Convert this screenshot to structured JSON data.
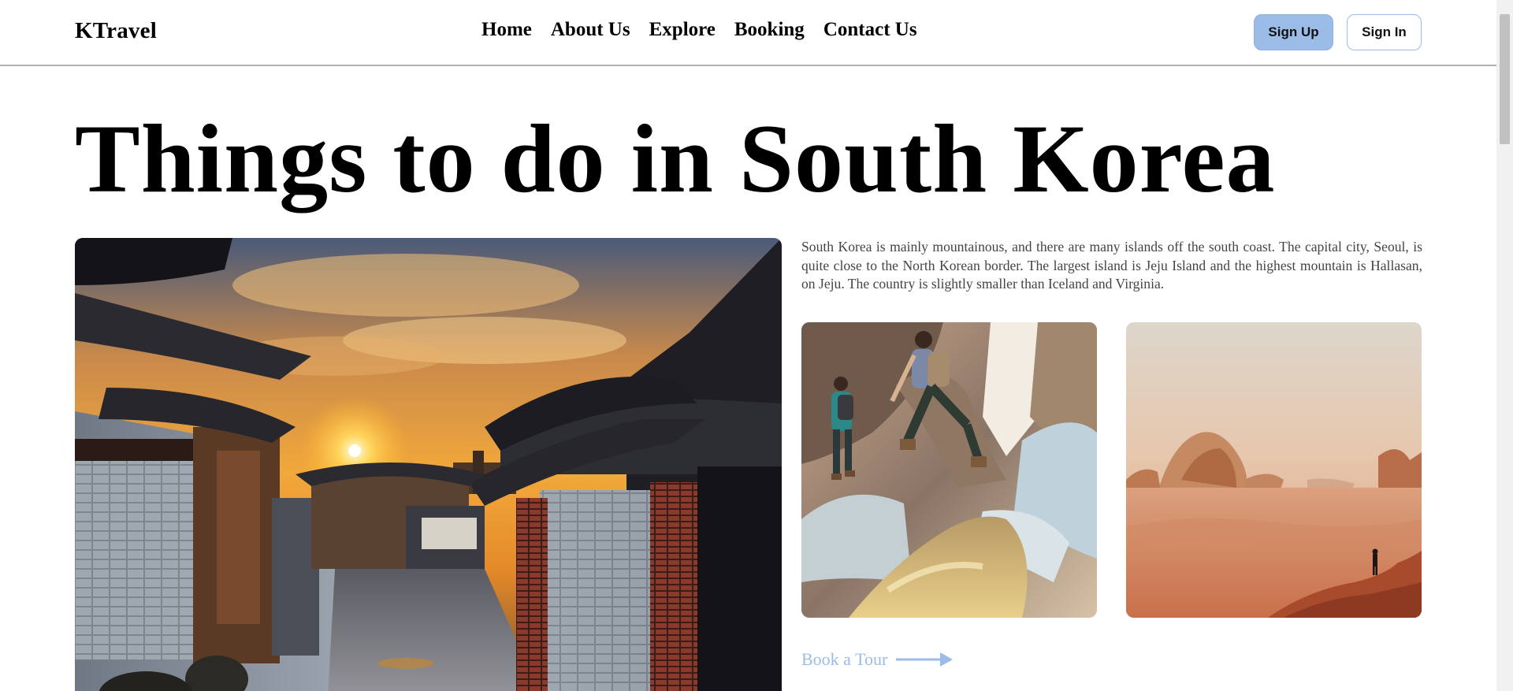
{
  "header": {
    "logo": "KTravel",
    "nav": {
      "home": "Home",
      "about": "About Us",
      "explore": "Explore",
      "booking": "Booking",
      "contact": "Contact Us"
    },
    "sign_up": "Sign Up",
    "sign_in": "Sign In"
  },
  "hero": {
    "title": "Things to do in South Korea",
    "description": "South Korea is mainly mountainous, and there are many islands off the south coast. The capital city, Seoul, is quite close to the North Korean border. The largest island is Jeju Island and the highest mountain is Hallasan, on Jeju. The country is slightly smaller than Iceland and Virginia.",
    "cta": "Book a Tour"
  },
  "colors": {
    "accent": "#9bbce6",
    "text": "#000000",
    "body_text": "#444444",
    "divider": "#b3b3b3"
  },
  "icons": {
    "cta_icon": "arrow-right-icon"
  }
}
